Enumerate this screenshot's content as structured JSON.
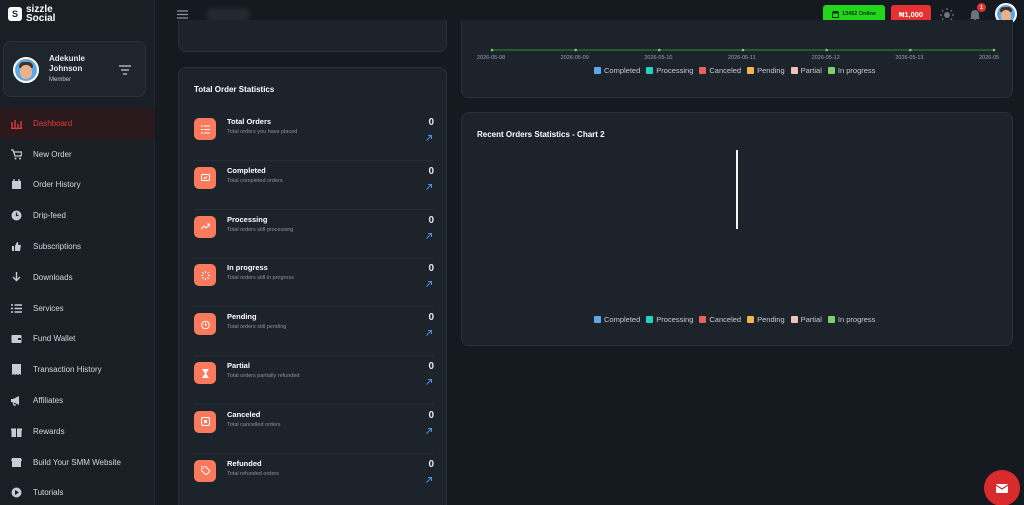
{
  "brand": {
    "logo_mark": "S",
    "name_line1": "sizzle",
    "name_line2": "Social",
    "logo_icon": "sizzle-logo-icon"
  },
  "user": {
    "name": "Adekunle Johnson",
    "role": "Member"
  },
  "topbar": {
    "online_label": "13452 Online",
    "wallet_balance": "₦1,000",
    "notifications_count": "1"
  },
  "sidebar": {
    "items": [
      {
        "label": "Dashboard",
        "icon": "chart-icon",
        "active": true
      },
      {
        "label": "New Order",
        "icon": "cart-icon"
      },
      {
        "label": "Order History",
        "icon": "calendar-icon"
      },
      {
        "label": "Drip-feed",
        "icon": "clock-icon"
      },
      {
        "label": "Subscriptions",
        "icon": "thumbs-up-icon"
      },
      {
        "label": "Downloads",
        "icon": "download-icon"
      },
      {
        "label": "Services",
        "icon": "list-icon"
      },
      {
        "label": "Fund Wallet",
        "icon": "wallet-icon"
      },
      {
        "label": "Transaction History",
        "icon": "receipt-icon"
      },
      {
        "label": "Affiliates",
        "icon": "megaphone-icon"
      },
      {
        "label": "Rewards",
        "icon": "gift-icon"
      },
      {
        "label": "Build Your SMM Website",
        "icon": "store-icon"
      },
      {
        "label": "Tutorials",
        "icon": "play-icon"
      }
    ]
  },
  "stats": {
    "title": "Total Order Statistics",
    "rows": [
      {
        "name": "Total Orders",
        "desc": "Total orders you have placed",
        "value": "0",
        "icon": "list-icon"
      },
      {
        "name": "Completed",
        "desc": "Total completed orders",
        "value": "0",
        "icon": "check-icon"
      },
      {
        "name": "Processing",
        "desc": "Total orders still processing",
        "value": "0",
        "icon": "trend-icon"
      },
      {
        "name": "In progress",
        "desc": "Total orders still in progress",
        "value": "0",
        "icon": "spinner-icon"
      },
      {
        "name": "Pending",
        "desc": "Total orders still pending",
        "value": "0",
        "icon": "timer-icon"
      },
      {
        "name": "Partial",
        "desc": "Total orders partially refunded",
        "value": "0",
        "icon": "hourglass-icon"
      },
      {
        "name": "Canceled",
        "desc": "Total cancelled orders",
        "value": "0",
        "icon": "cancel-icon"
      },
      {
        "name": "Refunded",
        "desc": "Total refunded orders",
        "value": "0",
        "icon": "tag-icon"
      }
    ]
  },
  "chart1": {
    "dates": [
      "2026-05-08",
      "2026-05-09",
      "2026-05-10",
      "2026-05-11",
      "2026-05-12",
      "2026-05-13",
      "2026-05"
    ]
  },
  "chart2": {
    "title": "Recent Orders Statistics - Chart 2"
  },
  "legend": [
    {
      "label": "Completed",
      "color": "#5fa8e8"
    },
    {
      "label": "Processing",
      "color": "#23d3c0"
    },
    {
      "label": "Canceled",
      "color": "#e8615a"
    },
    {
      "label": "Pending",
      "color": "#f0b452"
    },
    {
      "label": "Partial",
      "color": "#f3c0b8"
    },
    {
      "label": "In progress",
      "color": "#7ccf6a"
    }
  ],
  "colors": {
    "accent": "#e63131",
    "online": "#22d61c",
    "stat_icon": "#fb7a5d"
  }
}
